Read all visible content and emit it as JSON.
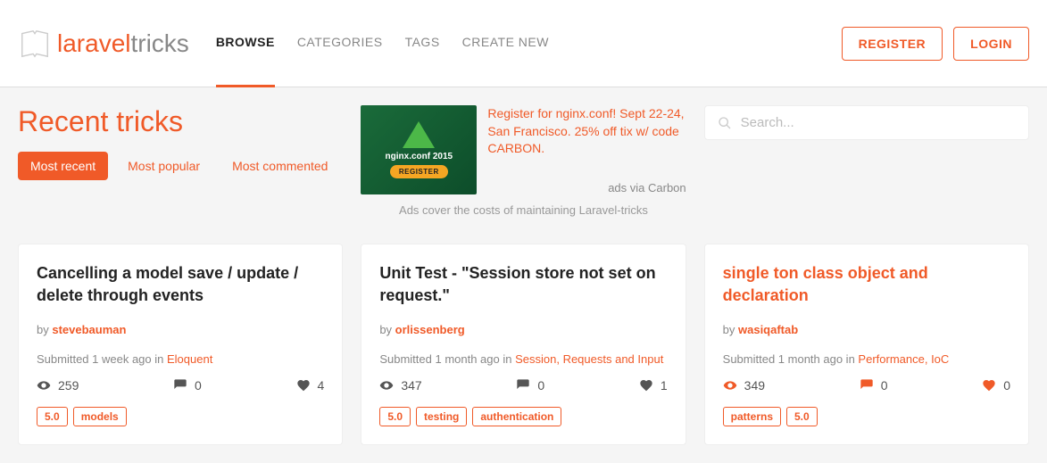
{
  "header": {
    "logo_main": "laravel",
    "logo_sub": "tricks",
    "nav": [
      {
        "label": "BROWSE",
        "active": true
      },
      {
        "label": "CATEGORIES",
        "active": false
      },
      {
        "label": "TAGS",
        "active": false
      },
      {
        "label": "CREATE NEW",
        "active": false
      }
    ],
    "register": "REGISTER",
    "login": "LOGIN"
  },
  "page": {
    "title": "Recent tricks",
    "filters": [
      {
        "label": "Most recent",
        "active": true
      },
      {
        "label": "Most popular",
        "active": false
      },
      {
        "label": "Most commented",
        "active": false
      }
    ]
  },
  "ad": {
    "conf_text": "nginx.conf 2015",
    "register_btn": "REGISTER",
    "text": "Register for nginx.conf! Sept 22-24, San Francisco. 25% off tix w/ code CARBON.",
    "via": "ads via Carbon",
    "footer": "Ads cover the costs of maintaining Laravel-tricks"
  },
  "search": {
    "placeholder": "Search..."
  },
  "cards": [
    {
      "title": "Cancelling a model save / update / delete through events",
      "title_orange": false,
      "by": "by ",
      "author": "stevebauman",
      "meta_prefix": "Submitted 1 week ago in ",
      "categories": "Eloquent",
      "views": "259",
      "comments": "0",
      "likes": "4",
      "icons_orange": false,
      "tags": [
        "5.0",
        "models"
      ]
    },
    {
      "title": "Unit Test - \"Session store not set on request.\"",
      "title_orange": false,
      "by": "by ",
      "author": "orlissenberg",
      "meta_prefix": "Submitted 1 month ago in ",
      "categories": "Session, Requests and Input",
      "views": "347",
      "comments": "0",
      "likes": "1",
      "icons_orange": false,
      "tags": [
        "5.0",
        "testing",
        "authentication"
      ]
    },
    {
      "title": "single ton class object and declaration",
      "title_orange": true,
      "by": "by ",
      "author": "wasiqaftab",
      "meta_prefix": "Submitted 1 month ago in ",
      "categories": "Performance, IoC",
      "views": "349",
      "comments": "0",
      "likes": "0",
      "icons_orange": true,
      "tags": [
        "patterns",
        "5.0"
      ]
    }
  ]
}
